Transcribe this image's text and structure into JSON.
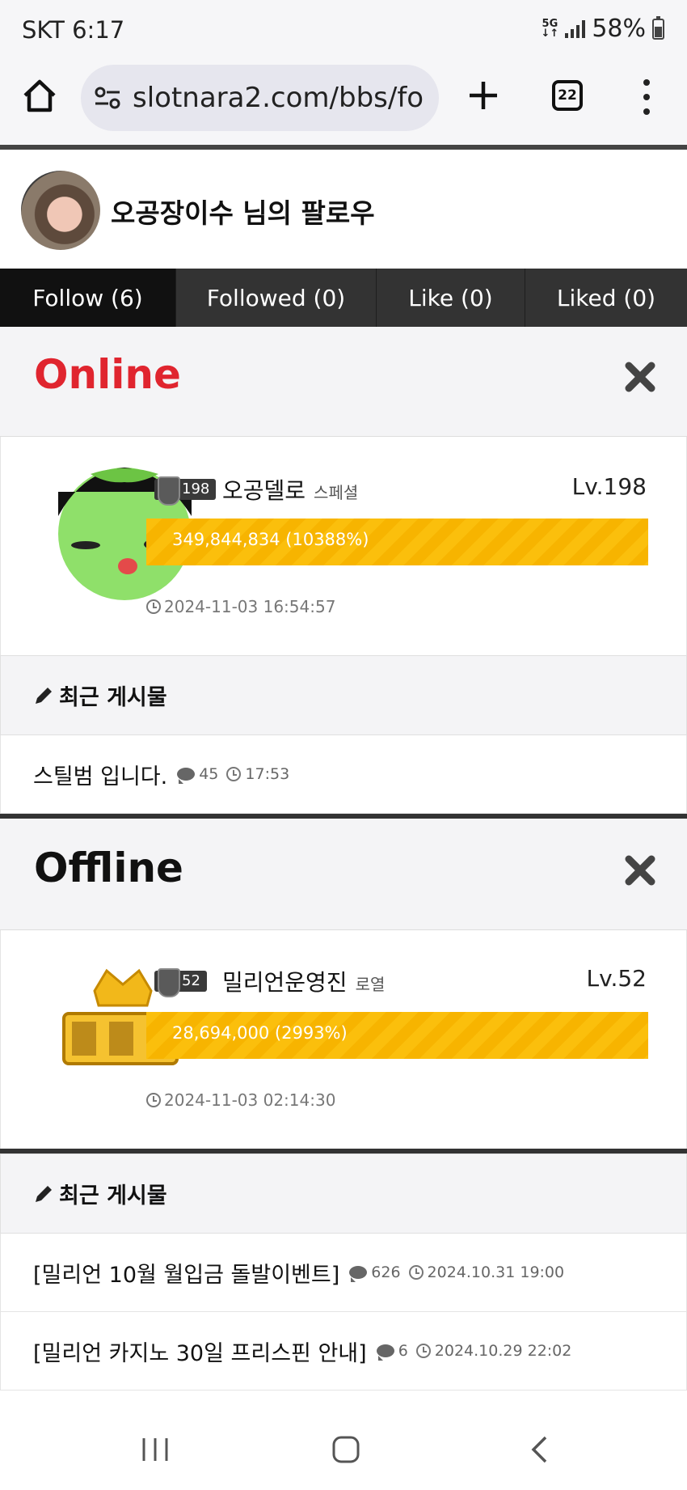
{
  "status": {
    "carrier_time": "SKT 6:17",
    "net": "5G",
    "battery": "58%"
  },
  "browser": {
    "url": "slotnara2.com/bbs/fo",
    "tab_count": "22"
  },
  "profile": {
    "title": "오공장이수 님의 팔로우"
  },
  "tabs": [
    {
      "label": "Follow (6)"
    },
    {
      "label": "Followed (0)"
    },
    {
      "label": "Like (0)"
    },
    {
      "label": "Liked (0)"
    }
  ],
  "online": {
    "title": "Online",
    "title_color": "#e0252f",
    "member": {
      "badge_level": "198",
      "name": "오공델로",
      "grade": "스페셜",
      "level": "Lv.198",
      "exp": "349,844,834 (10388%)",
      "last_seen": "2024-11-03 16:54:57"
    },
    "posts_header": "최근 게시물",
    "posts": [
      {
        "title": "스틸범 입니다.",
        "comments": "45",
        "time": "17:53"
      }
    ]
  },
  "offline": {
    "title": "Offline",
    "member": {
      "badge_level": "52",
      "name": "밀리언운영진",
      "grade": "로열",
      "level": "Lv.52",
      "exp": "28,694,000 (2993%)",
      "last_seen": "2024-11-03 02:14:30"
    },
    "posts_header": "최근 게시물",
    "posts": [
      {
        "title": "[밀리언 10월 월입금 돌발이벤트]",
        "comments": "626",
        "time": "2024.10.31 19:00"
      },
      {
        "title": "[밀리언 카지노 30일 프리스핀 안내]",
        "comments": "6",
        "time": "2024.10.29 22:02"
      }
    ]
  },
  "accent_bar_color": "#fbbf0c"
}
